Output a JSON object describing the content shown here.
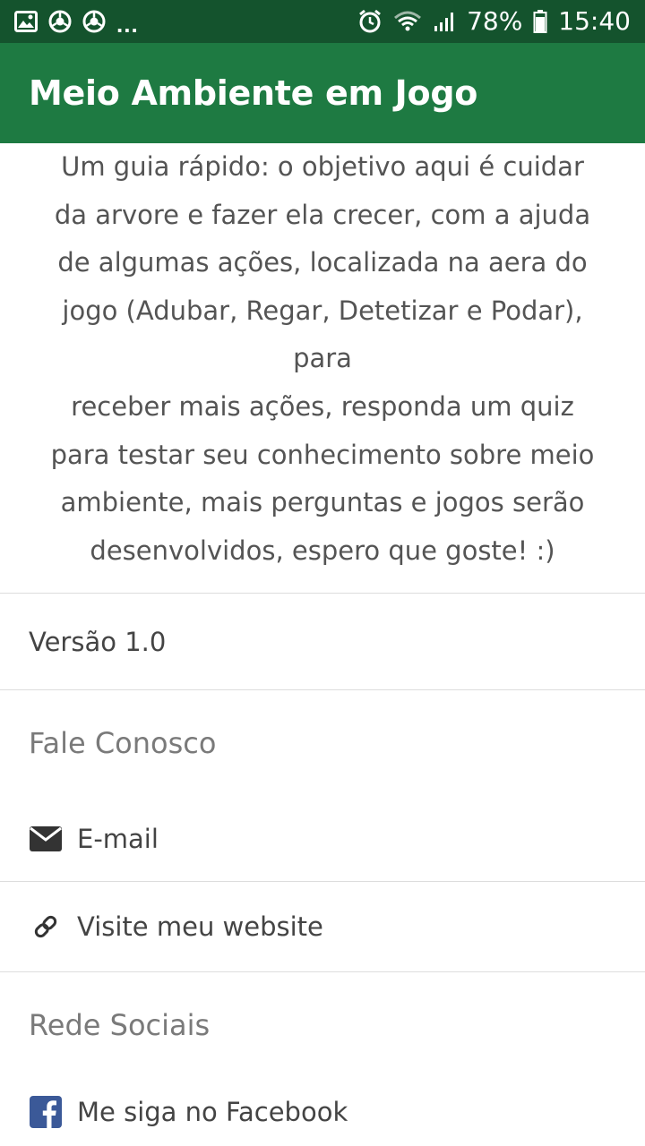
{
  "status_bar": {
    "left_icons": [
      "gallery-icon",
      "chrome-icon",
      "chrome-icon"
    ],
    "more": "...",
    "battery_percent": "78%",
    "time": "15:40",
    "right_icons": [
      "alarm-icon",
      "wifi-icon",
      "signal-icon",
      "battery-icon"
    ]
  },
  "app_bar": {
    "title": "Meio Ambiente em Jogo"
  },
  "intro": {
    "lines": [
      "Um guia rápido: o objetivo aqui é cuidar",
      "da arvore e fazer ela crecer, com a ajuda",
      "de algumas ações, localizada na aera do",
      "jogo (Adubar, Regar, Detetizar e Podar), para",
      "receber mais ações, responda um quiz",
      "para testar seu conhecimento sobre meio",
      "ambiente, mais perguntas e jogos serão",
      "desenvolvidos, espero que goste! :)"
    ]
  },
  "version": {
    "label": "Versão 1.0"
  },
  "contact": {
    "section_title": "Fale Conosco",
    "email_label": "E-mail",
    "email_icon": "envelope-icon",
    "website_label": "Visite meu website",
    "website_icon": "link-icon"
  },
  "social": {
    "section_title": "Rede Sociais",
    "facebook_label": "Me siga no Facebook",
    "facebook_icon": "facebook-icon"
  },
  "colors": {
    "status_bar": "#14532d",
    "app_bar": "#1e7a42",
    "facebook_blue": "#3b5998",
    "divider": "#dddddd"
  }
}
